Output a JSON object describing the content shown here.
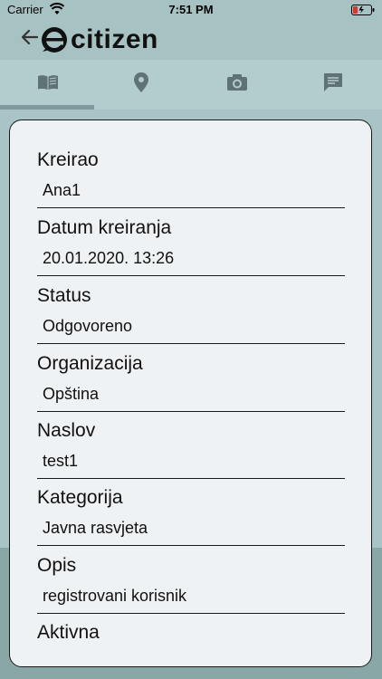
{
  "status_bar": {
    "carrier": "Carrier",
    "time": "7:51 PM"
  },
  "header": {
    "logo_text": "citizen",
    "back_icon": "back-arrow-icon"
  },
  "tabs": [
    {
      "icon": "book-icon"
    },
    {
      "icon": "location-pin-icon"
    },
    {
      "icon": "camera-icon"
    },
    {
      "icon": "comment-icon"
    }
  ],
  "fields": [
    {
      "label": "Kreirao",
      "value": "Ana1"
    },
    {
      "label": "Datum kreiranja",
      "value": "20.01.2020. 13:26"
    },
    {
      "label": "Status",
      "value": "Odgovoreno"
    },
    {
      "label": "Organizacija",
      "value": "Opština"
    },
    {
      "label": "Naslov",
      "value": "test1"
    },
    {
      "label": "Kategorija",
      "value": "Javna rasvjeta"
    },
    {
      "label": "Opis",
      "value": "registrovani korisnik"
    },
    {
      "label": "Aktivna",
      "value": ""
    }
  ],
  "colors": {
    "header_bg": "#a7c2c3",
    "tab_icon": "#5f7274",
    "tab_indicator": "#7f9a9c"
  }
}
